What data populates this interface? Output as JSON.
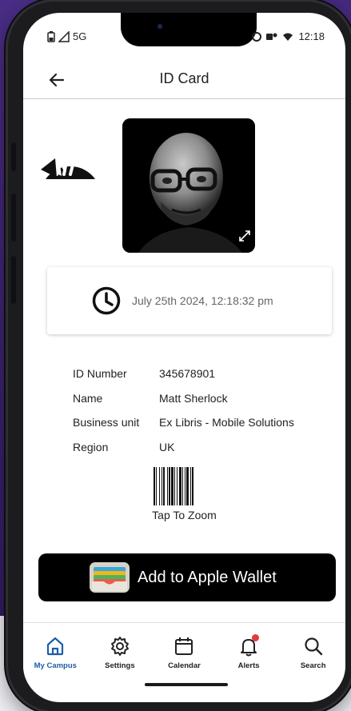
{
  "status_bar": {
    "network": "5G",
    "time": "12:18"
  },
  "header": {
    "title": "ID Card"
  },
  "card": {
    "timestamp": "July 25th 2024, 12:18:32 pm",
    "fields": [
      {
        "label": "ID Number",
        "value": "345678901"
      },
      {
        "label": "Name",
        "value": "Matt Sherlock"
      },
      {
        "label": "Business unit",
        "value": "Ex Libris - Mobile Solutions"
      },
      {
        "label": "Region",
        "value": "UK"
      }
    ],
    "barcode_caption": "Tap To Zoom"
  },
  "wallet_button": {
    "label": "Add to Apple Wallet"
  },
  "tabs": [
    {
      "label": "My Campus",
      "icon": "home-icon",
      "active": true
    },
    {
      "label": "Settings",
      "icon": "gear-icon"
    },
    {
      "label": "Calendar",
      "icon": "calendar-icon"
    },
    {
      "label": "Alerts",
      "icon": "bell-icon",
      "badge": true
    },
    {
      "label": "Search",
      "icon": "search-icon"
    }
  ],
  "colors": {
    "accent": "#1e5ea8",
    "alert": "#e23b3b",
    "background": "#3b226f"
  }
}
